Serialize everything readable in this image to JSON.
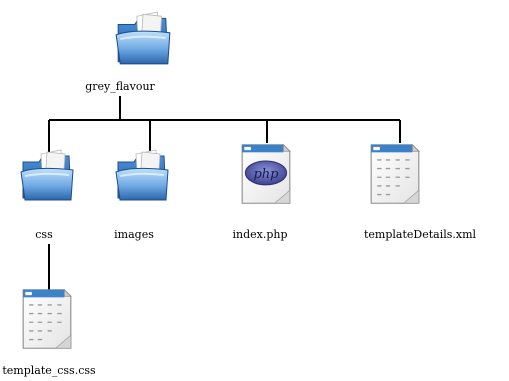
{
  "diagram": {
    "root": {
      "label": "grey_flavour",
      "icon": "folder-icon"
    },
    "children": [
      {
        "label": "css",
        "icon": "folder-icon"
      },
      {
        "label": "images",
        "icon": "folder-icon"
      },
      {
        "label": "index.php",
        "icon": "php-file-icon"
      },
      {
        "label": "templateDetails.xml",
        "icon": "text-file-icon"
      }
    ],
    "grandchildren": [
      {
        "label": "template_css.css",
        "icon": "text-file-icon",
        "parent": "css"
      }
    ]
  },
  "colors": {
    "connector": "#000000",
    "folder_light": "#8fc4ee",
    "folder_dark": "#2f6fb8",
    "file_header": "#3b82c8",
    "php_badge": "#5a5fa8"
  }
}
